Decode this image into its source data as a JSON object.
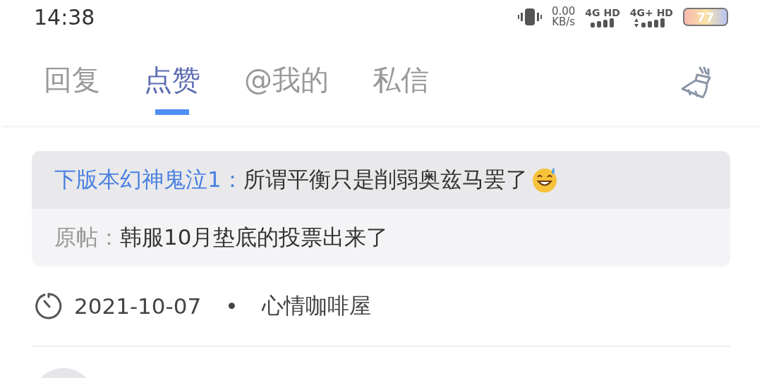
{
  "status_bar": {
    "time": "14:38",
    "speed_value": "0.00",
    "speed_unit": "KB/s",
    "network_1": "4G HD",
    "network_2": "4G+ HD",
    "battery": "77"
  },
  "tabs": [
    {
      "label": "回复",
      "selected": false
    },
    {
      "label": "点赞",
      "selected": true
    },
    {
      "label": "@我的",
      "selected": false
    },
    {
      "label": "私信",
      "selected": false
    }
  ],
  "items": [
    {
      "author": "下版本幻神鬼泣1：",
      "comment": "所谓平衡只是削弱奥兹马罢了",
      "original_label": "原帖：",
      "original_title": "韩服10月垫底的投票出来了",
      "date": "2021-10-07",
      "separator": "•",
      "forum": "心情咖啡屋"
    }
  ]
}
